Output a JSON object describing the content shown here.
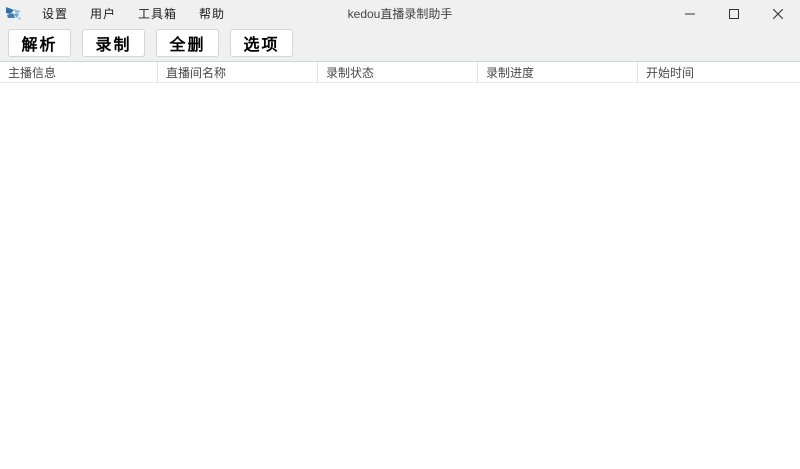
{
  "window": {
    "title": "kedou直播录制助手",
    "controls": {
      "minimize_label": "minimize",
      "maximize_label": "maximize",
      "close_label": "close"
    }
  },
  "menubar": {
    "items": [
      {
        "label": "设置"
      },
      {
        "label": "用户"
      },
      {
        "label": "工具箱"
      },
      {
        "label": "帮助"
      }
    ]
  },
  "toolbar": {
    "buttons": [
      {
        "label": "解析"
      },
      {
        "label": "录制"
      },
      {
        "label": "全删"
      },
      {
        "label": "选项"
      }
    ]
  },
  "table": {
    "columns": [
      {
        "label": "主播信息"
      },
      {
        "label": "直播间名称"
      },
      {
        "label": "录制状态"
      },
      {
        "label": "录制进度"
      },
      {
        "label": "开始时间"
      }
    ],
    "rows": []
  },
  "colors": {
    "titlebar_bg": "#f0f0f0",
    "toolbar_separator": "#ccd6dc",
    "header_border": "#e8e8e8",
    "icon_dark_blue": "#2f6ea5",
    "icon_mid_blue": "#4a8ec2",
    "icon_light_blue": "#8ec3e2"
  }
}
